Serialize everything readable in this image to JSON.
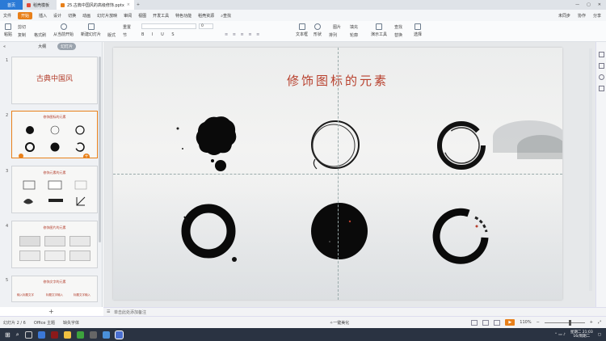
{
  "tabs": [
    {
      "label": "首页"
    },
    {
      "label": "稻壳模板"
    },
    {
      "label": "25.古典中国风的高级修饰.pptx"
    }
  ],
  "menus": [
    "文件",
    "开始",
    "插入",
    "设计",
    "切换",
    "动画",
    "幻灯片放映",
    "审阅",
    "视图",
    "开发工具",
    "特色功能",
    "稻壳资源",
    "查找"
  ],
  "menu_right": [
    "未同步",
    "协作",
    "分享"
  ],
  "ribbon": {
    "paste": "粘贴",
    "cut": "剪切",
    "copy": "复制",
    "format_painter": "格式刷",
    "play_from_current": "从当前开始",
    "new_slide": "新建幻灯片",
    "layout": "版式",
    "section": "节",
    "reset": "重置",
    "font_size": "0",
    "textbox": "文本框",
    "shapes": "形状",
    "arrange": "排列",
    "picture": "图片",
    "fill": "填充",
    "outline": "轮廓",
    "presentation_tools": "演示工具",
    "find": "查找",
    "replace": "替换",
    "select": "选择"
  },
  "left_panel": {
    "view_outline": "大纲",
    "view_slides": "幻灯片",
    "thumbs": [
      {
        "num": "1",
        "title": "古典中国风"
      },
      {
        "num": "2",
        "title": "修饰图标的元素"
      },
      {
        "num": "3",
        "title": "修饰元素的元素"
      },
      {
        "num": "4",
        "title": "修饰图片的元素"
      },
      {
        "num": "5",
        "title": "修饰文字的元素",
        "subs": [
          "输入标题文字",
          "标题文字输入",
          "标题文字输入"
        ]
      }
    ],
    "add": "+"
  },
  "slide": {
    "title": "修饰图标的元素"
  },
  "notes_placeholder": "单击此处添加备注",
  "status": {
    "slide_pos": "幻灯片 2 / 6",
    "theme": "Office 主题",
    "font_missing": "缺失字体",
    "beautify": "一键美化",
    "zoom": "110%"
  },
  "taskbar": {
    "time": "星期二 21:03",
    "date": "16/周期二"
  },
  "colors": {
    "accent": "#e8801a",
    "title_red": "#b8402d",
    "tab_blue": "#2b7ad6"
  }
}
